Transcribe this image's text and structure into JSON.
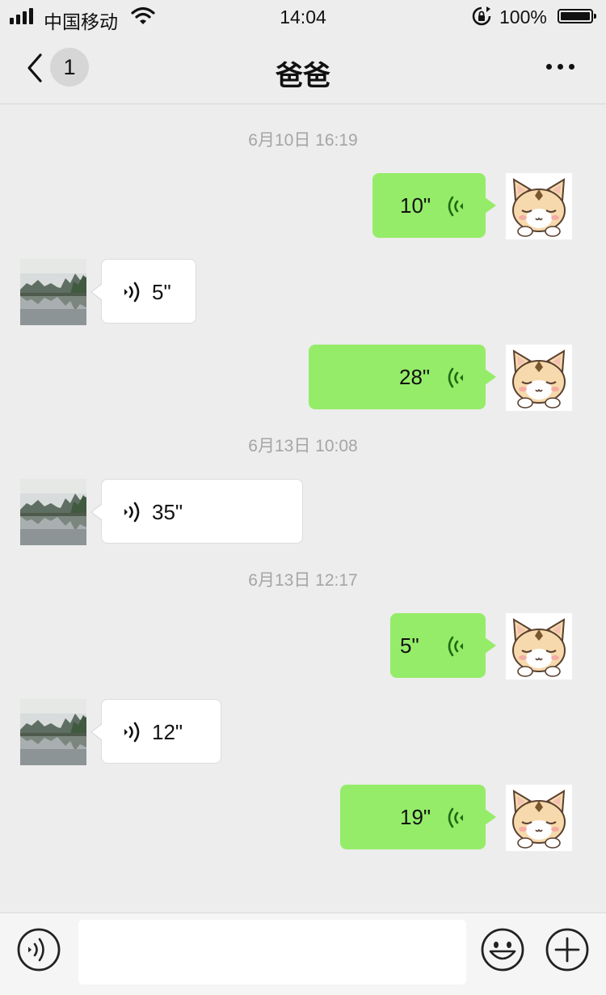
{
  "status_bar": {
    "carrier": "中国移动",
    "time": "14:04",
    "battery": "100%",
    "signal_bars": 4
  },
  "nav": {
    "title": "爸爸",
    "unread_count": "1"
  },
  "messages": [
    {
      "type": "timestamp",
      "text": "6月10日 16:19"
    },
    {
      "type": "voice",
      "side": "sent",
      "duration": "10\""
    },
    {
      "type": "voice",
      "side": "received",
      "duration": "5\""
    },
    {
      "type": "voice",
      "side": "sent",
      "duration": "28\""
    },
    {
      "type": "timestamp",
      "text": "6月13日 10:08"
    },
    {
      "type": "voice",
      "side": "received",
      "duration": "35\""
    },
    {
      "type": "timestamp",
      "text": "6月13日 12:17"
    },
    {
      "type": "voice",
      "side": "sent",
      "duration": "5\""
    },
    {
      "type": "voice",
      "side": "received",
      "duration": "12\""
    },
    {
      "type": "voice",
      "side": "sent",
      "duration": "19\""
    }
  ],
  "input_bar": {
    "voice_button_icon": "voice-mode-icon",
    "emoji_button_icon": "emoji-icon",
    "more_button_icon": "plus-icon",
    "text_value": ""
  },
  "colors": {
    "sent_bubble": "#95ec69",
    "received_bubble": "#ffffff",
    "chat_background": "#ededed",
    "voice_icon_sent": "#1e6b12"
  }
}
